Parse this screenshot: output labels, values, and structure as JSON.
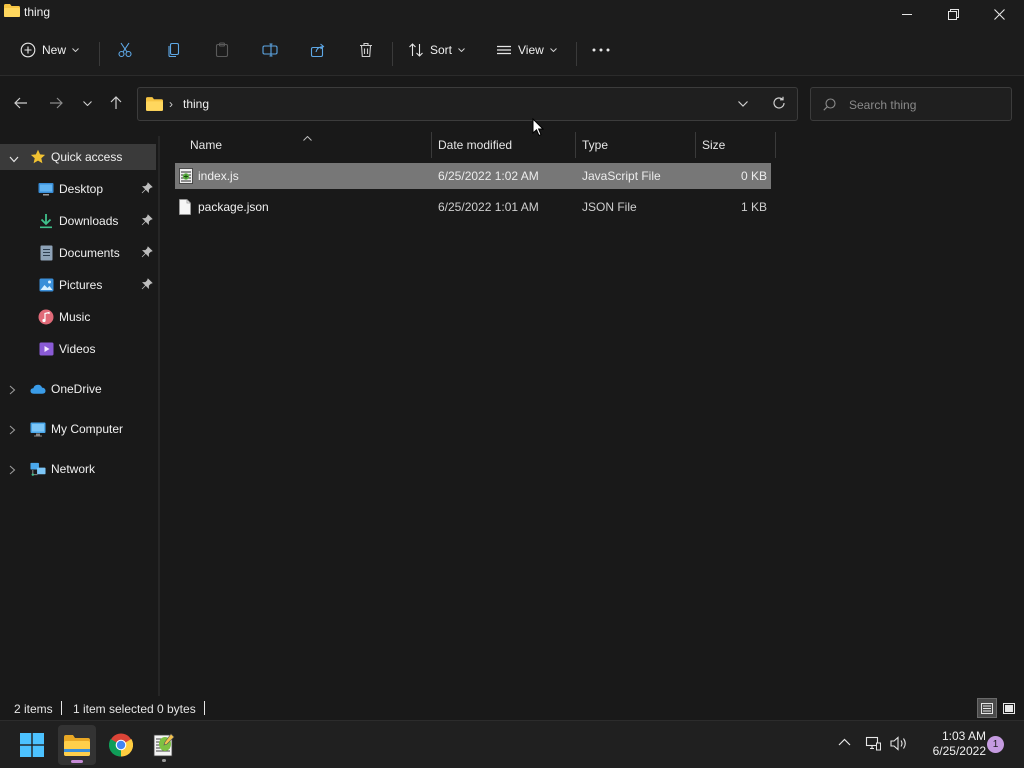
{
  "window": {
    "title": "thing"
  },
  "toolbar": {
    "new_label": "New",
    "sort_label": "Sort",
    "view_label": "View"
  },
  "address": {
    "crumb_separator": "›",
    "folder": "thing"
  },
  "search": {
    "placeholder": "Search thing"
  },
  "nav": {
    "quick_access": "Quick access",
    "items": [
      {
        "label": "Desktop",
        "icon": "desktop-icon",
        "pinned": true
      },
      {
        "label": "Downloads",
        "icon": "downloads-icon",
        "pinned": true
      },
      {
        "label": "Documents",
        "icon": "documents-icon",
        "pinned": true
      },
      {
        "label": "Pictures",
        "icon": "pictures-icon",
        "pinned": true
      },
      {
        "label": "Music",
        "icon": "music-icon",
        "pinned": false
      },
      {
        "label": "Videos",
        "icon": "videos-icon",
        "pinned": false
      }
    ],
    "roots": [
      {
        "label": "OneDrive",
        "icon": "onedrive-icon"
      },
      {
        "label": "My Computer",
        "icon": "computer-icon"
      },
      {
        "label": "Network",
        "icon": "network-icon"
      }
    ]
  },
  "columns": {
    "name": "Name",
    "date": "Date modified",
    "type": "Type",
    "size": "Size"
  },
  "files": [
    {
      "name": "index.js",
      "date": "6/25/2022 1:02 AM",
      "type": "JavaScript File",
      "size": "0 KB",
      "selected": true,
      "icon": "js-file-icon"
    },
    {
      "name": "package.json",
      "date": "6/25/2022 1:01 AM",
      "type": "JSON File",
      "size": "1 KB",
      "selected": false,
      "icon": "json-file-icon"
    }
  ],
  "status": {
    "item_count": "2 items",
    "selection": "1 item selected",
    "selection_size": "0 bytes"
  },
  "taskbar": {
    "time": "1:03 AM",
    "date": "6/25/2022",
    "notification_count": "1"
  },
  "colors": {
    "background": "#191919",
    "selected_row": "#777777",
    "accent_folder": "#f6c443",
    "notification": "#c59be0"
  }
}
